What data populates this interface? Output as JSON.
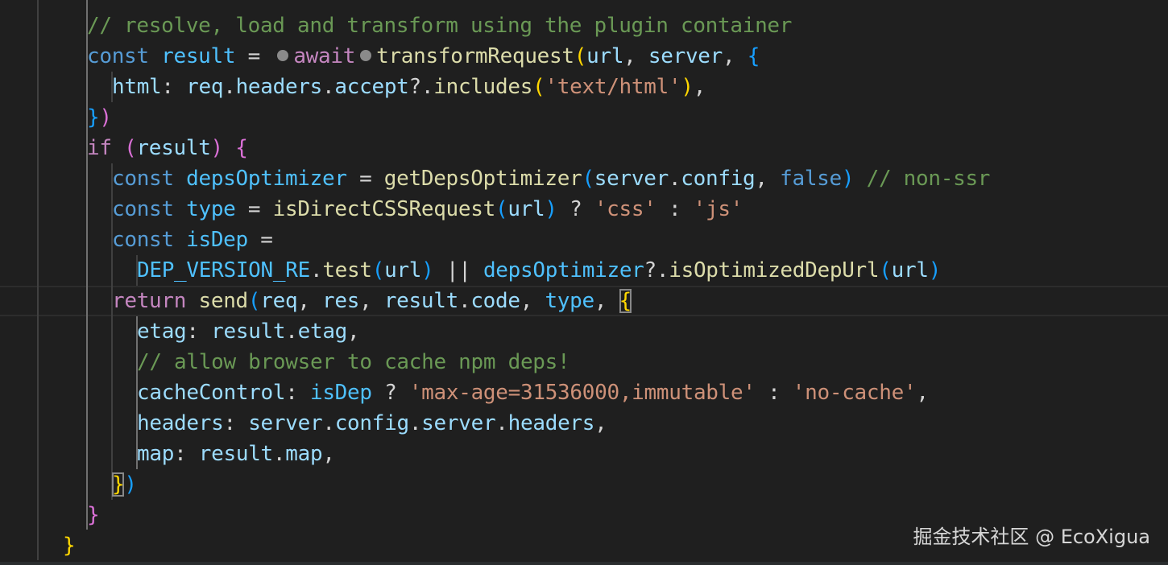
{
  "lines": [
    {
      "tokens": [
        {
          "t": "// resolve, load and transform using the plugin container",
          "c": "tok-comment"
        }
      ]
    },
    {
      "tokens": [
        {
          "t": "const ",
          "c": "tok-kw"
        },
        {
          "t": "result",
          "c": "tok-const"
        },
        {
          "t": " = ",
          "c": "tok-op"
        },
        {
          "t": "",
          "c": "inlay"
        },
        {
          "t": "await",
          "c": "tok-ctrl"
        },
        {
          "t": "",
          "c": "inlay"
        },
        {
          "t": "transformRequest",
          "c": "tok-fn"
        },
        {
          "t": "(",
          "c": "b1"
        },
        {
          "t": "url",
          "c": "tok-var"
        },
        {
          "t": ", ",
          "c": "tok-op"
        },
        {
          "t": "server",
          "c": "tok-var"
        },
        {
          "t": ", ",
          "c": "tok-op"
        },
        {
          "t": "{",
          "c": "b3"
        }
      ]
    },
    {
      "tokens": [
        {
          "t": "html",
          "c": "tok-var"
        },
        {
          "t": ": ",
          "c": "tok-op"
        },
        {
          "t": "req",
          "c": "tok-var"
        },
        {
          "t": ".",
          "c": "tok-op"
        },
        {
          "t": "headers",
          "c": "tok-var"
        },
        {
          "t": ".",
          "c": "tok-op"
        },
        {
          "t": "accept",
          "c": "tok-var"
        },
        {
          "t": "?.",
          "c": "tok-op"
        },
        {
          "t": "includes",
          "c": "tok-fn"
        },
        {
          "t": "(",
          "c": "b1"
        },
        {
          "t": "'text/html'",
          "c": "tok-str"
        },
        {
          "t": ")",
          "c": "b1"
        },
        {
          "t": ",",
          "c": "tok-op"
        }
      ]
    },
    {
      "tokens": [
        {
          "t": "}",
          "c": "b3"
        },
        {
          "t": ")",
          "c": "b2"
        }
      ]
    },
    {
      "tokens": [
        {
          "t": "if ",
          "c": "tok-ctrl"
        },
        {
          "t": "(",
          "c": "b2"
        },
        {
          "t": "result",
          "c": "tok-var"
        },
        {
          "t": ")",
          "c": "b2"
        },
        {
          "t": " ",
          "c": "tok-op"
        },
        {
          "t": "{",
          "c": "b2"
        }
      ]
    },
    {
      "tokens": [
        {
          "t": "const ",
          "c": "tok-kw"
        },
        {
          "t": "depsOptimizer",
          "c": "tok-const"
        },
        {
          "t": " = ",
          "c": "tok-op"
        },
        {
          "t": "getDepsOptimizer",
          "c": "tok-fn"
        },
        {
          "t": "(",
          "c": "b3"
        },
        {
          "t": "server",
          "c": "tok-var"
        },
        {
          "t": ".",
          "c": "tok-op"
        },
        {
          "t": "config",
          "c": "tok-var"
        },
        {
          "t": ", ",
          "c": "tok-op"
        },
        {
          "t": "false",
          "c": "tok-kw"
        },
        {
          "t": ")",
          "c": "b3"
        },
        {
          "t": " // non-ssr",
          "c": "tok-comment"
        }
      ]
    },
    {
      "tokens": [
        {
          "t": "const ",
          "c": "tok-kw"
        },
        {
          "t": "type",
          "c": "tok-const"
        },
        {
          "t": " = ",
          "c": "tok-op"
        },
        {
          "t": "isDirectCSSRequest",
          "c": "tok-fn"
        },
        {
          "t": "(",
          "c": "b3"
        },
        {
          "t": "url",
          "c": "tok-var"
        },
        {
          "t": ")",
          "c": "b3"
        },
        {
          "t": " ? ",
          "c": "tok-op"
        },
        {
          "t": "'css'",
          "c": "tok-str"
        },
        {
          "t": " : ",
          "c": "tok-op"
        },
        {
          "t": "'js'",
          "c": "tok-str"
        }
      ]
    },
    {
      "tokens": [
        {
          "t": "const ",
          "c": "tok-kw"
        },
        {
          "t": "isDep",
          "c": "tok-const"
        },
        {
          "t": " =",
          "c": "tok-op"
        }
      ]
    },
    {
      "tokens": [
        {
          "t": "DEP_VERSION_RE",
          "c": "tok-const"
        },
        {
          "t": ".",
          "c": "tok-op"
        },
        {
          "t": "test",
          "c": "tok-fn"
        },
        {
          "t": "(",
          "c": "b3"
        },
        {
          "t": "url",
          "c": "tok-var"
        },
        {
          "t": ")",
          "c": "b3"
        },
        {
          "t": " || ",
          "c": "tok-op"
        },
        {
          "t": "depsOptimizer",
          "c": "tok-const"
        },
        {
          "t": "?.",
          "c": "tok-op"
        },
        {
          "t": "isOptimizedDepUrl",
          "c": "tok-fn"
        },
        {
          "t": "(",
          "c": "b3"
        },
        {
          "t": "url",
          "c": "tok-var"
        },
        {
          "t": ")",
          "c": "b3"
        }
      ]
    },
    {
      "tokens": [
        {
          "t": "return ",
          "c": "tok-ctrl"
        },
        {
          "t": "send",
          "c": "tok-fn"
        },
        {
          "t": "(",
          "c": "b3"
        },
        {
          "t": "req",
          "c": "tok-var"
        },
        {
          "t": ", ",
          "c": "tok-op"
        },
        {
          "t": "res",
          "c": "tok-var"
        },
        {
          "t": ", ",
          "c": "tok-op"
        },
        {
          "t": "result",
          "c": "tok-var"
        },
        {
          "t": ".",
          "c": "tok-op"
        },
        {
          "t": "code",
          "c": "tok-var"
        },
        {
          "t": ", ",
          "c": "tok-op"
        },
        {
          "t": "type",
          "c": "tok-const"
        },
        {
          "t": ", ",
          "c": "tok-op"
        },
        {
          "t": "{",
          "c": "b1 match"
        }
      ]
    },
    {
      "tokens": [
        {
          "t": "etag",
          "c": "tok-var"
        },
        {
          "t": ": ",
          "c": "tok-op"
        },
        {
          "t": "result",
          "c": "tok-var"
        },
        {
          "t": ".",
          "c": "tok-op"
        },
        {
          "t": "etag",
          "c": "tok-var"
        },
        {
          "t": ",",
          "c": "tok-op"
        }
      ]
    },
    {
      "tokens": [
        {
          "t": "// allow browser to cache npm deps!",
          "c": "tok-comment"
        }
      ]
    },
    {
      "tokens": [
        {
          "t": "cacheControl",
          "c": "tok-var"
        },
        {
          "t": ": ",
          "c": "tok-op"
        },
        {
          "t": "isDep",
          "c": "tok-const"
        },
        {
          "t": " ? ",
          "c": "tok-op"
        },
        {
          "t": "'max-age=31536000,immutable'",
          "c": "tok-str"
        },
        {
          "t": " : ",
          "c": "tok-op"
        },
        {
          "t": "'no-cache'",
          "c": "tok-str"
        },
        {
          "t": ",",
          "c": "tok-op"
        }
      ]
    },
    {
      "tokens": [
        {
          "t": "headers",
          "c": "tok-var"
        },
        {
          "t": ": ",
          "c": "tok-op"
        },
        {
          "t": "server",
          "c": "tok-var"
        },
        {
          "t": ".",
          "c": "tok-op"
        },
        {
          "t": "config",
          "c": "tok-var"
        },
        {
          "t": ".",
          "c": "tok-op"
        },
        {
          "t": "server",
          "c": "tok-var"
        },
        {
          "t": ".",
          "c": "tok-op"
        },
        {
          "t": "headers",
          "c": "tok-var"
        },
        {
          "t": ",",
          "c": "tok-op"
        }
      ]
    },
    {
      "tokens": [
        {
          "t": "map",
          "c": "tok-var"
        },
        {
          "t": ": ",
          "c": "tok-op"
        },
        {
          "t": "result",
          "c": "tok-var"
        },
        {
          "t": ".",
          "c": "tok-op"
        },
        {
          "t": "map",
          "c": "tok-var"
        },
        {
          "t": ",",
          "c": "tok-op"
        }
      ]
    },
    {
      "tokens": [
        {
          "t": "}",
          "c": "b1 match"
        },
        {
          "t": ")",
          "c": "b3"
        }
      ]
    },
    {
      "tokens": [
        {
          "t": "}",
          "c": "b2"
        }
      ]
    },
    {
      "tokens": [
        {
          "t": "}",
          "c": "b1"
        }
      ]
    }
  ],
  "watermark": "掘金技术社区 @ EcoXigua"
}
